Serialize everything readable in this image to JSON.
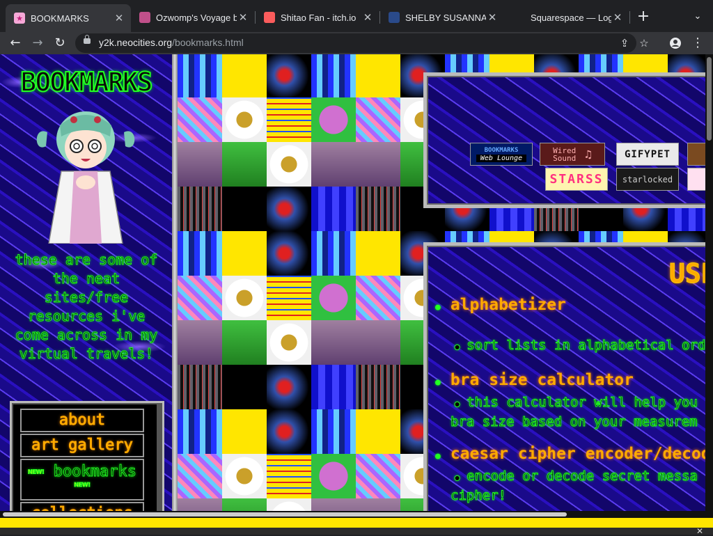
{
  "browser": {
    "tabs": [
      {
        "title": "BOOKMARKS",
        "active": true,
        "icon": "pink-star-icon"
      },
      {
        "title": "Ozwomp's Voyage b",
        "active": false,
        "icon": "pixel-art-icon"
      },
      {
        "title": "Shitao Fan - itch.io",
        "active": false,
        "icon": "itchio-icon"
      },
      {
        "title": "SHELBY SUSANNAH",
        "active": false,
        "icon": "square-logo-icon"
      },
      {
        "title": "Squarespace — Log",
        "active": false,
        "icon": "squarespace-icon"
      }
    ],
    "url_host": "y2k.neocities.org",
    "url_path": "/bookmarks.html"
  },
  "sidebar": {
    "logo": "BOOKMARKS",
    "blurb": "these are some of the neat sites/free resources i've come across in my virtual travels!",
    "nav": [
      {
        "label": "about",
        "new": false
      },
      {
        "label": "art gallery",
        "new": false
      },
      {
        "label": "bookmarks",
        "new": true
      },
      {
        "label": "collections",
        "new": false
      }
    ],
    "new_badge": "NEW!"
  },
  "buttons88": [
    {
      "label": "Web Lounge",
      "sub": "BOOKMARKS"
    },
    {
      "label": "Wired Sound"
    },
    {
      "label": "GIFYPET"
    },
    {
      "label": "STARSS"
    },
    {
      "label": "starlocked"
    }
  ],
  "tools": {
    "title": "USE",
    "items": [
      {
        "name": "alphabetizer",
        "desc": [
          "sort lists in alphabetical ord"
        ]
      },
      {
        "name": "bra size calculator",
        "desc": [
          "this calculator will help you",
          "bra size based on your measurem"
        ]
      },
      {
        "name": "caesar cipher encoder/decod",
        "desc": [
          "encode or decode secret messa",
          "cipher!"
        ]
      }
    ]
  },
  "colors": {
    "neon_green": "#22ff22",
    "neon_orange": "#ffaa00",
    "bg_blue": "#1a0a8a",
    "yellow": "#ffe600"
  }
}
